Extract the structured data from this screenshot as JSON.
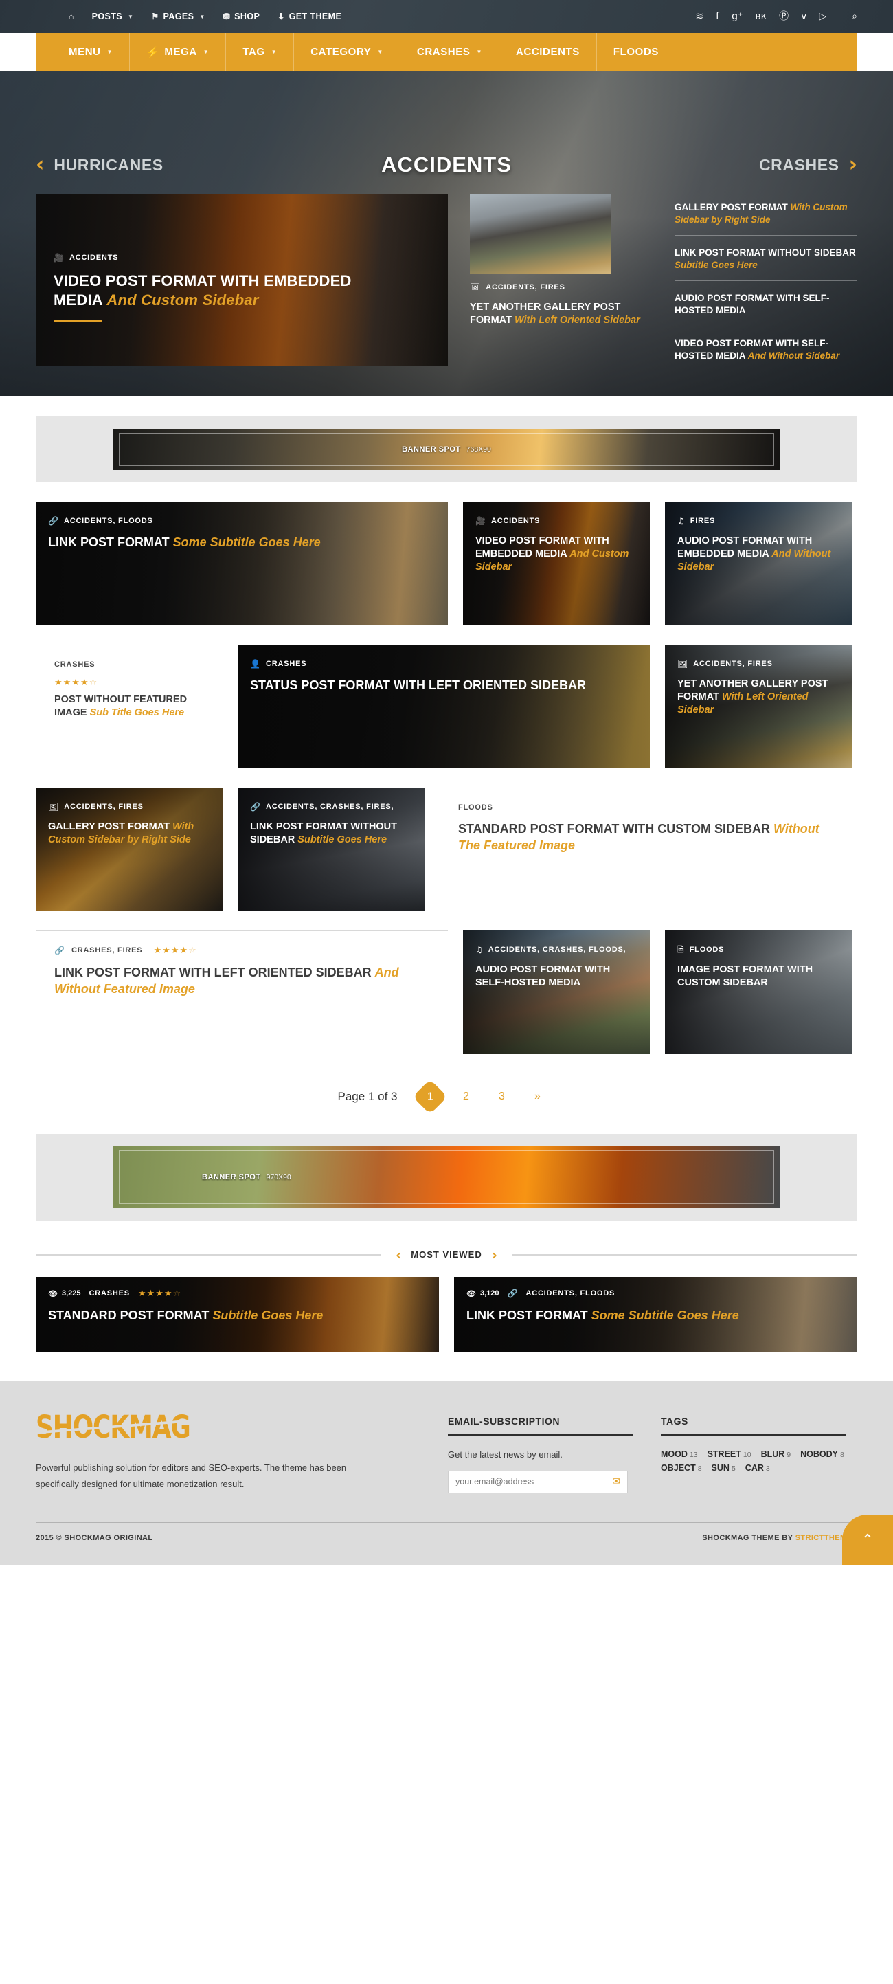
{
  "topbar": {
    "nav": [
      {
        "icon": "home-icon",
        "glyph": "⌂",
        "label": "",
        "caret": false
      },
      {
        "icon": "",
        "glyph": "",
        "label": "POSTS",
        "caret": true
      },
      {
        "icon": "flag-icon",
        "glyph": "⚑",
        "label": "PAGES",
        "caret": true
      },
      {
        "icon": "cart-icon",
        "glyph": "⛃",
        "label": "SHOP",
        "caret": false
      },
      {
        "icon": "download-icon",
        "glyph": "⬇",
        "label": "GET THEME",
        "caret": false
      }
    ],
    "social": [
      {
        "name": "rss-icon",
        "glyph": "≋"
      },
      {
        "name": "facebook-icon",
        "glyph": "f"
      },
      {
        "name": "google-plus-icon",
        "glyph": "g⁺"
      },
      {
        "name": "vk-icon",
        "glyph": "вк"
      },
      {
        "name": "pinterest-icon",
        "glyph": "Ⓟ"
      },
      {
        "name": "twitter-icon",
        "glyph": "ᴠ"
      },
      {
        "name": "vimeo-icon",
        "glyph": "▷"
      }
    ],
    "search_icon": "⌕"
  },
  "mainnav": [
    {
      "label": "MENU",
      "caret": true,
      "icon": ""
    },
    {
      "label": "MEGA",
      "caret": true,
      "icon": "⚡"
    },
    {
      "label": "TAG",
      "caret": true,
      "icon": ""
    },
    {
      "label": "CATEGORY",
      "caret": true,
      "icon": ""
    },
    {
      "label": "CRASHES",
      "caret": true,
      "icon": ""
    },
    {
      "label": "ACCIDENTS",
      "caret": false,
      "icon": ""
    },
    {
      "label": "FLOODS",
      "caret": false,
      "icon": ""
    }
  ],
  "header": {
    "logo": "SHOCKMAG",
    "banner": {
      "label": "BANNER SPOT",
      "size": "768X90"
    }
  },
  "hero": {
    "prev_category": "HURRICANES",
    "current_category": "ACCIDENTS",
    "next_category": "CRASHES",
    "prev_arrow": "‹",
    "next_arrow": "›",
    "main": {
      "category_icon": "video-camera-icon",
      "category_glyph": "🎥",
      "categories": "ACCIDENTS",
      "title": "VIDEO POST FORMAT WITH EMBEDDED MEDIA ",
      "subtitle": "And Custom Sidebar"
    },
    "mid": {
      "category_icon": "gallery-icon",
      "category_glyph": "❑",
      "categories": "ACCIDENTS, FIRES",
      "title": "YET ANOTHER GALLERY POST FORMAT ",
      "subtitle": "With Left Oriented Sidebar"
    },
    "list": [
      {
        "title": "GALLERY POST FORMAT ",
        "subtitle": "With Custom Sidebar by Right Side"
      },
      {
        "title": "LINK POST FORMAT WITHOUT SIDEBAR ",
        "subtitle": "Subtitle Goes Here"
      },
      {
        "title": "AUDIO POST FORMAT WITH SELF-HOSTED MEDIA",
        "subtitle": ""
      },
      {
        "title": "VIDEO POST FORMAT WITH SELF-HOSTED MEDIA ",
        "subtitle": "And Without Sidebar"
      }
    ]
  },
  "ad_top": {
    "label": "BANNER SPOT",
    "size": "768X90"
  },
  "ad_bottom": {
    "label": "BANNER SPOT",
    "size": "970X90"
  },
  "posts": {
    "row1": [
      {
        "cat_icon": "link-icon",
        "cat_glyph": "🔗",
        "categories": "ACCIDENTS, FLOODS",
        "title": "LINK POST FORMAT ",
        "subtitle": "Some Subtitle Goes Here",
        "theme": "dark",
        "size": "wide"
      },
      {
        "cat_icon": "video-camera-icon",
        "cat_glyph": "🎥",
        "categories": "ACCIDENTS",
        "title": "VIDEO POST FORMAT WITH EMBEDDED MEDIA ",
        "subtitle": "And Custom Sidebar",
        "theme": "dark",
        "size": "normal"
      },
      {
        "cat_icon": "music-note-icon",
        "cat_glyph": "♫",
        "categories": "FIRES",
        "title": "AUDIO POST FORMAT WITH EMBEDDED MEDIA ",
        "subtitle": "And Without Sidebar",
        "theme": "dark",
        "size": "normal"
      }
    ],
    "row2": [
      {
        "cat_icon": "",
        "cat_glyph": "",
        "categories": "CRASHES",
        "rating": 4,
        "title": "POST WITHOUT FEATURED IMAGE ",
        "subtitle": "Sub Title Goes Here",
        "theme": "light",
        "size": "normal"
      },
      {
        "cat_icon": "user-icon",
        "cat_glyph": "👤",
        "categories": "CRASHES",
        "title": "STATUS POST FORMAT WITH LEFT ORIENTED SIDEBAR",
        "subtitle": "",
        "theme": "dark",
        "size": "wide"
      },
      {
        "cat_icon": "gallery-icon",
        "cat_glyph": "❑",
        "categories": "ACCIDENTS, FIRES",
        "title": "YET ANOTHER GALLERY POST FORMAT ",
        "subtitle": "With Left Oriented Sidebar",
        "theme": "dark",
        "size": "normal"
      }
    ],
    "row3": [
      {
        "cat_icon": "gallery-icon",
        "cat_glyph": "❑",
        "categories": "ACCIDENTS, FIRES",
        "title": "GALLERY POST FORMAT ",
        "subtitle": "With Custom Sidebar by Right Side",
        "theme": "dark",
        "size": "narrow"
      },
      {
        "cat_icon": "link-icon",
        "cat_glyph": "🔗",
        "categories": "ACCIDENTS, CRASHES, FIRES,",
        "title": "LINK POST FORMAT WITHOUT SIDEBAR ",
        "subtitle": "Subtitle Goes Here",
        "theme": "dark",
        "size": "narrow"
      },
      {
        "cat_icon": "",
        "cat_glyph": "",
        "categories": "FLOODS",
        "title": "STANDARD POST FORMAT WITH CUSTOM SIDEBAR ",
        "subtitle": "Without The Featured Image",
        "theme": "light",
        "size": "wide"
      }
    ],
    "row4": [
      {
        "cat_icon": "link-icon",
        "cat_glyph": "🔗",
        "categories": "CRASHES, FIRES",
        "rating": 4,
        "title": "LINK POST FORMAT WITH LEFT ORIENTED SIDEBAR ",
        "subtitle": "And Without Featured Image",
        "theme": "light",
        "size": "wide"
      },
      {
        "cat_icon": "music-note-icon",
        "cat_glyph": "♫",
        "categories": "ACCIDENTS, CRASHES, FLOODS,",
        "title": "AUDIO POST FORMAT WITH SELF-HOSTED MEDIA",
        "subtitle": "",
        "theme": "dark",
        "size": "normal"
      },
      {
        "cat_icon": "image-icon",
        "cat_glyph": "❑",
        "categories": "FLOODS",
        "title": "IMAGE POST FORMAT WITH CUSTOM SIDEBAR",
        "subtitle": "",
        "theme": "dark",
        "size": "normal"
      }
    ]
  },
  "pagination": {
    "label": "Page 1 of 3",
    "pages": [
      "1",
      "2",
      "3",
      "»"
    ],
    "active": "1"
  },
  "most_viewed": {
    "heading": "MOST VIEWED",
    "prev_arrow": "‹",
    "next_arrow": "›",
    "items": [
      {
        "views_icon": "eye-icon",
        "views": "3,225",
        "categories": "CRASHES",
        "rating": 4,
        "title": "STANDARD POST FORMAT ",
        "subtitle": "Subtitle Goes Here",
        "cat_icon": "",
        "cat_glyph": ""
      },
      {
        "views_icon": "eye-icon",
        "views": "3,120",
        "categories": "ACCIDENTS, FLOODS",
        "rating": 0,
        "title": "LINK POST FORMAT ",
        "subtitle": "Some Subtitle Goes Here",
        "cat_icon": "link-icon",
        "cat_glyph": "🔗"
      }
    ]
  },
  "footer": {
    "logo": "SHOCKMAG",
    "about": "Powerful publishing solution for editors and SEO-experts. The theme has been specifically designed for ultimate monetization result.",
    "subscription": {
      "heading": "EMAIL-SUBSCRIPTION",
      "text": "Get the latest news by email.",
      "placeholder": "your.email@address",
      "submit_icon": "envelope-icon",
      "submit_glyph": "✉"
    },
    "tags": {
      "heading": "TAGS",
      "items": [
        {
          "label": "MOOD",
          "count": "13"
        },
        {
          "label": "STREET",
          "count": "10"
        },
        {
          "label": "BLUR",
          "count": "9"
        },
        {
          "label": "NOBODY",
          "count": "8"
        },
        {
          "label": "OBJECT",
          "count": "8"
        },
        {
          "label": "SUN",
          "count": "5"
        },
        {
          "label": "CAR",
          "count": "3"
        }
      ]
    },
    "copyright": "2015 © SHOCKMAG ORIGINAL",
    "credit_prefix": "SHOCKMAG THEME BY ",
    "credit_link": "STRICTTHEMES",
    "to_top_icon": "chevron-up-icon",
    "to_top_glyph": "⌃"
  },
  "colors": {
    "accent": "#e3a127",
    "dark": "#0d0d0d",
    "topbar": "#2f3a42"
  }
}
